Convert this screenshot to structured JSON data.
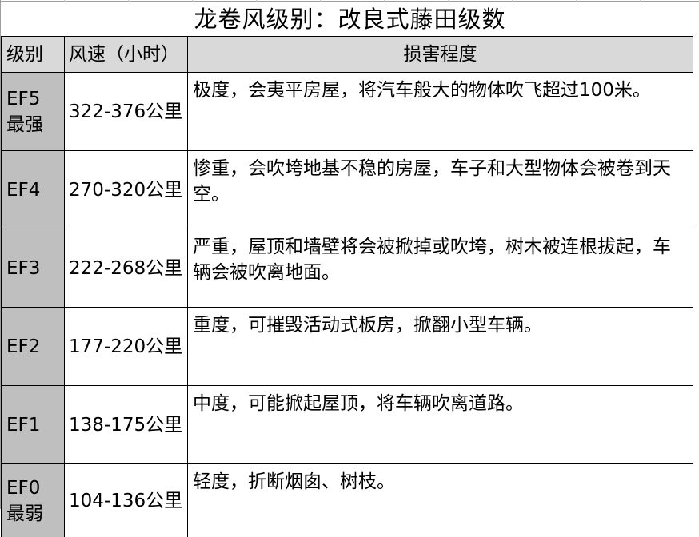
{
  "title": "龙卷风级别：改良式藤田级数",
  "table": {
    "headers": {
      "level": "级别",
      "speed": "风速（小时）",
      "damage": "损害程度"
    },
    "rows": [
      {
        "level": "EF5",
        "level_note": "最强",
        "speed": "322-376公里",
        "damage": "极度，会夷平房屋，将汽车般大的物体吹飞超过100米。"
      },
      {
        "level": "EF4",
        "level_note": "",
        "speed": "270-320公里",
        "damage": "惨重，会吹垮地基不稳的房屋，车子和大型物体会被卷到天空。"
      },
      {
        "level": "EF3",
        "level_note": "",
        "speed": "222-268公里",
        "damage": "严重，屋顶和墙壁将会被掀掉或吹垮，树木被连根拔起，车辆会被吹离地面。"
      },
      {
        "level": "EF2",
        "level_note": "",
        "speed": "177-220公里",
        "damage": "重度，可摧毁活动式板房，掀翻小型车辆。"
      },
      {
        "level": "EF1",
        "level_note": "",
        "speed": "138-175公里",
        "damage": "中度，可能掀起屋顶，将车辆吹离道路。"
      },
      {
        "level": "EF0",
        "level_note": "最弱",
        "speed": "104-136公里",
        "damage": "轻度，折断烟囱、树枝。"
      }
    ]
  },
  "colors": {
    "header_bg": "#d9d9d9",
    "level_col_bg": "#bfbfbf",
    "border": "#000000"
  }
}
